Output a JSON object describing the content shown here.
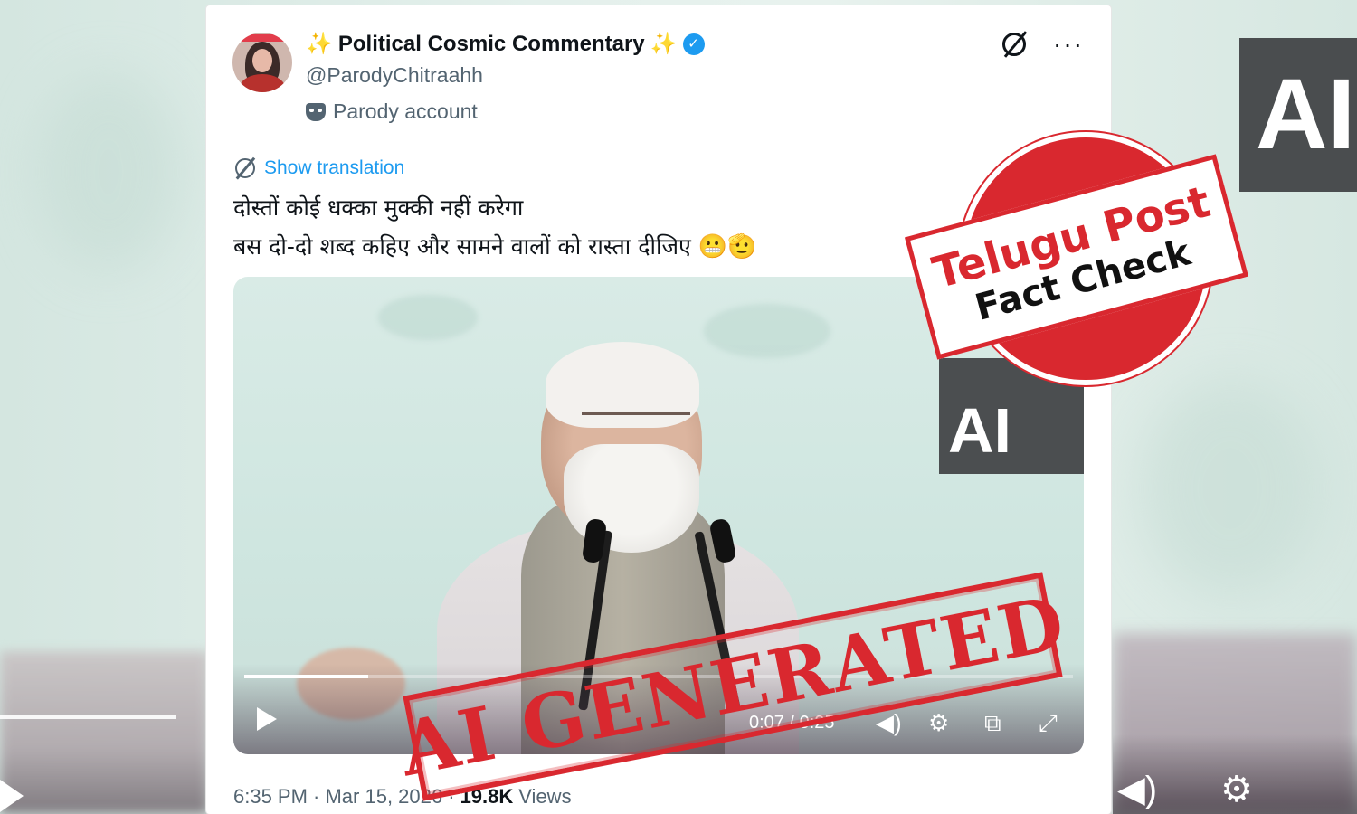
{
  "tweet": {
    "display_name": "Political Cosmic Commentary",
    "sparkle_left": "✨",
    "sparkle_right": "✨",
    "verified_glyph": "✓",
    "handle": "@ParodyChitraahh",
    "parody_label": "Parody account",
    "show_translation": "Show translation",
    "text_line1": "दोस्तों कोई धक्का मुक्की नहीं करेगा",
    "text_line2": "बस दो-दो शब्द कहिए और सामने वालों को रास्ता दीजिए",
    "text_emojis": "😬🫡",
    "timestamp": "6:35 PM · Mar 15, 2026 ·",
    "views_count": "19.8K",
    "views_label": "Views",
    "more_glyph": "···"
  },
  "video": {
    "time_display": "0:07 / 0:25",
    "progress": 0.15,
    "overlay_text": "AI",
    "icons": [
      "volume-icon",
      "settings-icon",
      "pip-icon",
      "fullscreen-icon"
    ]
  },
  "background": {
    "overlay_text": "AI"
  },
  "stamps": {
    "telugu_title": "Telugu Post",
    "telugu_sub": "Fact Check",
    "ai_generated": "AI GENERATED",
    "stamp_color": "#d9282f"
  },
  "colors": {
    "accent_blue": "#1d9bf0",
    "text_primary": "#0f1419",
    "text_secondary": "#536471"
  }
}
